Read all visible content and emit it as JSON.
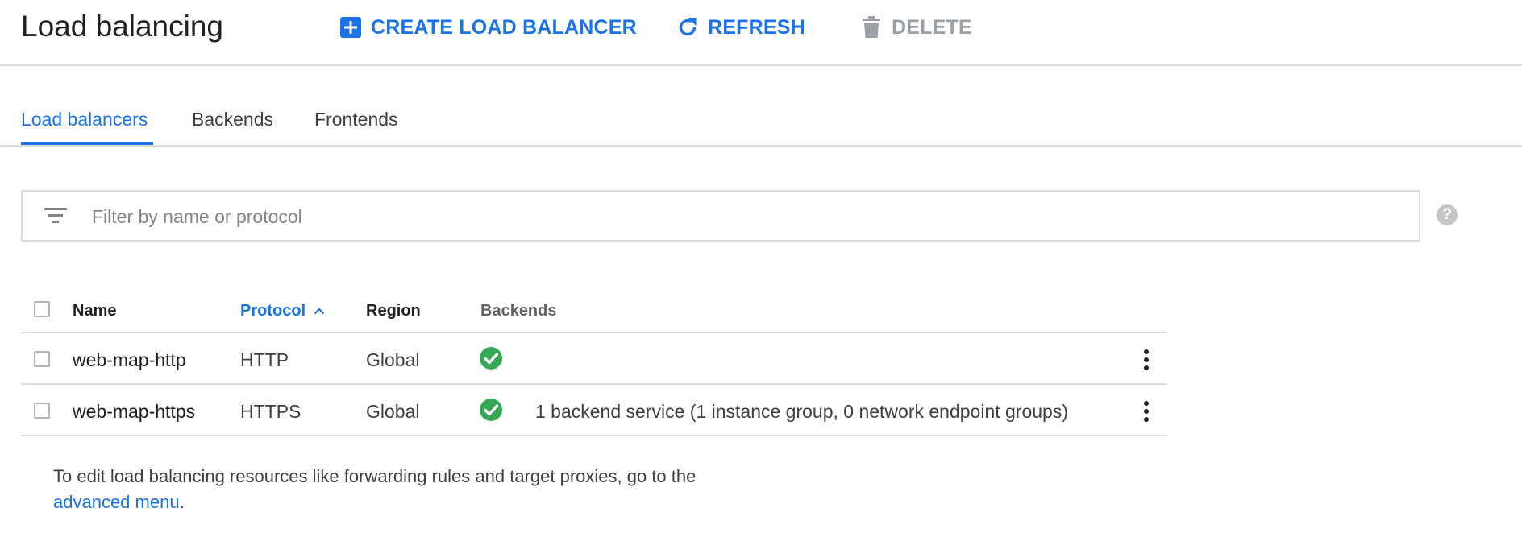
{
  "header": {
    "title": "Load balancing",
    "actions": {
      "create": "CREATE LOAD BALANCER",
      "refresh": "REFRESH",
      "delete": "DELETE"
    }
  },
  "tabs": [
    {
      "label": "Load balancers",
      "active": true
    },
    {
      "label": "Backends",
      "active": false
    },
    {
      "label": "Frontends",
      "active": false
    }
  ],
  "filter": {
    "placeholder": "Filter by name or protocol",
    "value": "",
    "help_icon": "?"
  },
  "table": {
    "columns": {
      "name": "Name",
      "protocol": "Protocol",
      "region": "Region",
      "backends": "Backends"
    },
    "sort": {
      "column": "protocol",
      "direction": "ascending"
    },
    "rows": [
      {
        "name": "web-map-http",
        "protocol": "HTTP",
        "region": "Global",
        "backend_status": "healthy",
        "backends_text": ""
      },
      {
        "name": "web-map-https",
        "protocol": "HTTPS",
        "region": "Global",
        "backend_status": "healthy",
        "backends_text": "1 backend service (1 instance group, 0 network endpoint groups)"
      }
    ]
  },
  "footnote": {
    "text": "To edit load balancing resources like forwarding rules and target proxies, go to the",
    "link": "advanced menu",
    "suffix": "."
  },
  "colors": {
    "accent": "#1a73e8",
    "success": "#34a853",
    "disabled": "#9aa0a6"
  },
  "icons": {
    "create": "add-box-icon",
    "refresh": "refresh-icon",
    "delete": "trash-icon",
    "filter": "filter-icon",
    "help": "help-icon",
    "status": "check-circle-icon",
    "row_menu": "more-vert-icon",
    "sort": "chevron-up-icon"
  }
}
